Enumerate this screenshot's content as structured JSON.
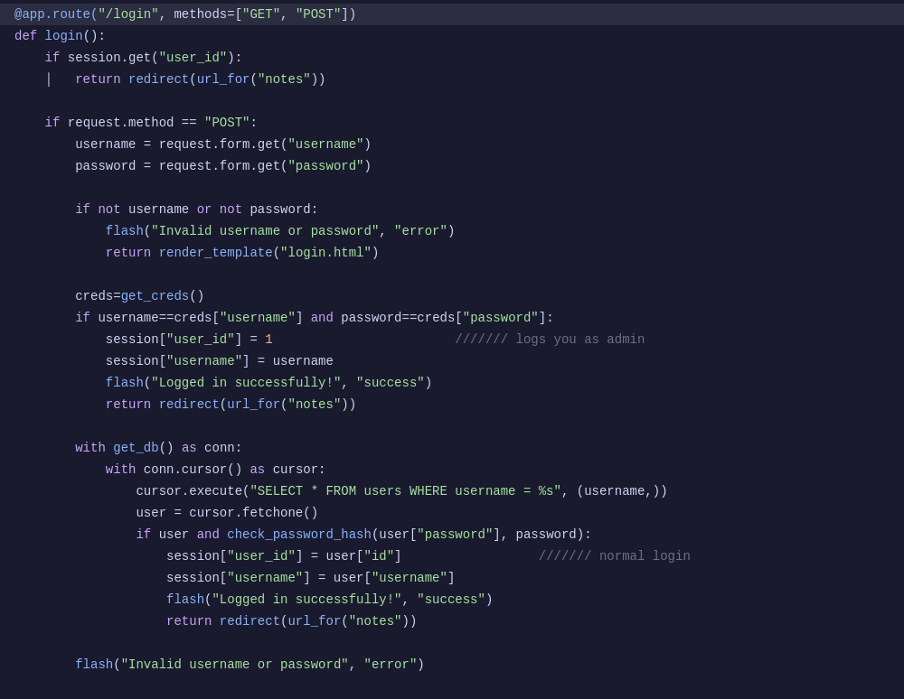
{
  "editor": {
    "background": "#1a1a2e",
    "lines": [
      {
        "id": 1,
        "highlighted": true,
        "content": "@app.route(\"/login\", methods=[\"GET\", \"POST\"])"
      }
    ]
  }
}
